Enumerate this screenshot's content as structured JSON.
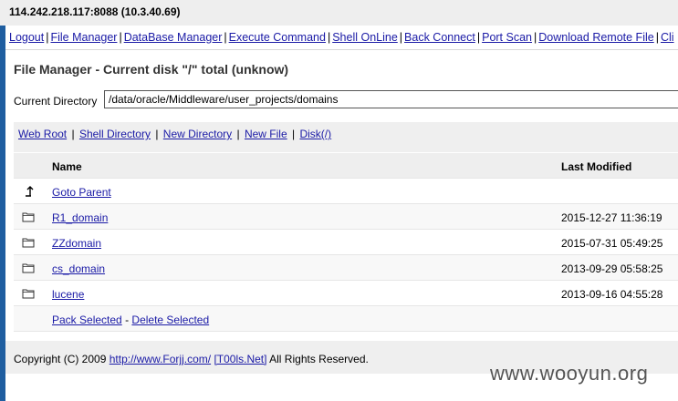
{
  "titlebar": {
    "text": "114.242.218.117:8088 (10.3.40.69)"
  },
  "nav": {
    "items": [
      "Logout",
      "File Manager",
      "DataBase Manager",
      "Execute Command",
      "Shell OnLine",
      "Back Connect",
      "Port Scan",
      "Download Remote File",
      "Cli"
    ],
    "separator": "|"
  },
  "page": {
    "heading": "File Manager - Current disk \"/\" total (unknow)",
    "current_dir_label": "Current Directory",
    "current_dir_value": "/data/oracle/Middleware/user_projects/domains"
  },
  "toolbar": {
    "links": [
      "Web Root",
      "Shell Directory",
      "New Directory",
      "New File",
      "Disk(/)"
    ],
    "separator": "|"
  },
  "table": {
    "headers": {
      "name": "Name",
      "modified": "Last Modified"
    },
    "parent_label": "Goto Parent",
    "rows": [
      {
        "name": "R1_domain",
        "modified": "2015-12-27 11:36:19"
      },
      {
        "name": "ZZdomain",
        "modified": "2015-07-31 05:49:25"
      },
      {
        "name": "cs_domain",
        "modified": "2013-09-29 05:58:25"
      },
      {
        "name": "lucene",
        "modified": "2013-09-16 04:55:28"
      }
    ],
    "actions": {
      "pack": "Pack Selected",
      "dash": "-",
      "delete": "Delete Selected"
    }
  },
  "footer": {
    "prefix": "Copyright (C) 2009",
    "link1": "http://www.Forjj.com/",
    "link2": "[T00ls.Net]",
    "suffix": "All Rights Reserved."
  },
  "watermark": "www.wooyun.org"
}
